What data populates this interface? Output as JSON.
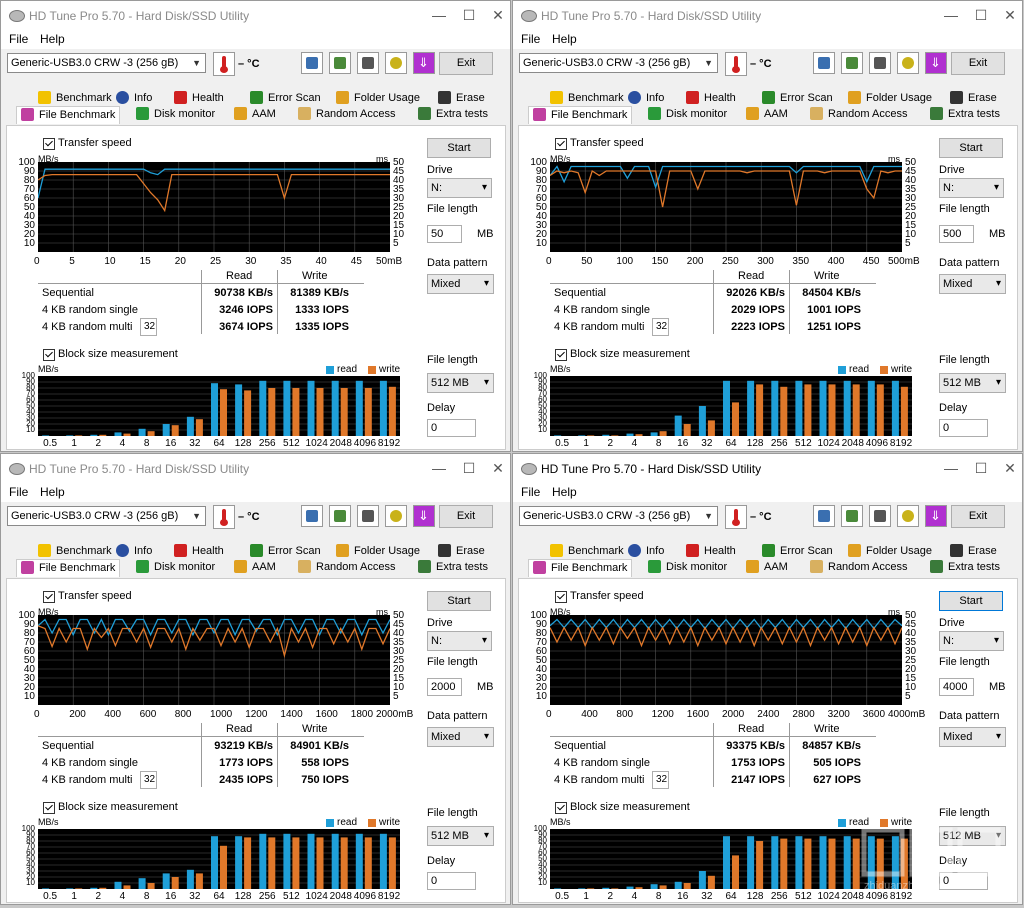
{
  "app": {
    "title": "HD Tune Pro 5.70 - Hard Disk/SSD Utility",
    "menu": [
      "File",
      "Help"
    ],
    "drive_name": "Generic-USB3.0 CRW   -3 (256 gB)",
    "temp": "– °C",
    "exit_label": "Exit",
    "tabs_row1": [
      "Benchmark",
      "Info",
      "Health",
      "Error Scan",
      "Folder Usage",
      "Erase"
    ],
    "tabs_row2": [
      "File Benchmark",
      "Disk monitor",
      "AAM",
      "Random Access",
      "Extra tests"
    ],
    "transfer_speed_label": "Transfer speed",
    "block_size_label": "Block size measurement",
    "start_label": "Start",
    "drive_label": "Drive",
    "drive_value": "N:",
    "file_length_label": "File length",
    "unit_mb": "MB",
    "data_pattern_label": "Data pattern",
    "data_pattern_value": "Mixed",
    "delay_label": "Delay",
    "delay_value": "0",
    "block_file_length": "512 MB",
    "mbs": "MB/s",
    "ms": "ms",
    "read_label": "Read",
    "write_label": "Write",
    "sequential": "Sequential",
    "kb_single": "4 KB random single",
    "kb_multi": "4 KB random multi",
    "queue": "32",
    "legend_read": "read",
    "legend_write": "write",
    "left_ticks": [
      "100",
      "90",
      "80",
      "70",
      "60",
      "50",
      "40",
      "30",
      "20",
      "10"
    ],
    "right_ticks": [
      "50",
      "45",
      "40",
      "35",
      "30",
      "25",
      "20",
      "15",
      "10",
      "5"
    ],
    "block_y_ticks": [
      "100",
      "90",
      "80",
      "70",
      "60",
      "50",
      "40",
      "30",
      "20",
      "10"
    ],
    "block_x": [
      "0.5",
      "1",
      "2",
      "4",
      "8",
      "16",
      "32",
      "64",
      "128",
      "256",
      "512",
      "1024",
      "2048",
      "4096",
      "8192"
    ],
    "colors": {
      "read": "#1f9fd8",
      "write": "#e0782a"
    },
    "watermark": "zhiduanzhi.com"
  },
  "windows": [
    {
      "file_length": "50",
      "x_ticks": [
        "0",
        "5",
        "10",
        "15",
        "20",
        "25",
        "30",
        "35",
        "40",
        "45",
        "50mB"
      ],
      "seq_read": "90738 KB/s",
      "seq_write": "81389 KB/s",
      "single_read": "3246 IOPS",
      "single_write": "1333 IOPS",
      "multi_read": "3674 IOPS",
      "multi_write": "1335 IOPS",
      "chart_data": {
        "type": "line",
        "x": [
          0,
          1,
          2,
          3,
          4,
          5,
          6,
          7,
          8,
          9,
          10,
          11,
          12,
          13,
          14,
          15,
          16,
          17,
          18,
          19,
          20,
          21,
          22,
          23,
          24,
          25,
          26,
          27,
          28,
          29,
          30,
          31,
          32,
          33,
          34,
          35,
          36,
          37,
          38,
          39,
          40,
          41,
          42,
          43,
          44,
          45,
          46,
          47,
          48,
          49,
          50
        ],
        "series": [
          {
            "name": "read",
            "values": [
              60,
              92,
              92,
              92,
              92,
              92,
              92,
              92,
              92,
              92,
              92,
              92,
              92,
              92,
              92,
              92,
              88,
              86,
              92,
              92,
              92,
              92,
              92,
              92,
              92,
              92,
              92,
              92,
              92,
              92,
              92,
              92,
              92,
              92,
              92,
              92,
              92,
              92,
              92,
              92,
              92,
              92,
              92,
              92,
              92,
              92,
              92,
              92,
              92,
              92,
              92
            ]
          },
          {
            "name": "write",
            "values": [
              80,
              85,
              86,
              86,
              86,
              86,
              86,
              86,
              86,
              86,
              86,
              86,
              86,
              86,
              86,
              76,
              66,
              58,
              46,
              86,
              86,
              86,
              86,
              86,
              86,
              86,
              86,
              86,
              86,
              86,
              86,
              86,
              86,
              86,
              86,
              60,
              86,
              86,
              86,
              86,
              86,
              86,
              86,
              86,
              86,
              86,
              86,
              86,
              86,
              86,
              86
            ]
          }
        ],
        "ylim": [
          0,
          100
        ],
        "block_read": [
          1,
          1,
          2,
          6,
          12,
          20,
          32,
          88,
          86,
          92,
          92,
          92,
          92,
          92,
          92
        ],
        "block_write": [
          0,
          1,
          2,
          4,
          8,
          18,
          28,
          78,
          76,
          80,
          80,
          80,
          80,
          80,
          82
        ]
      }
    },
    {
      "file_length": "500",
      "x_ticks": [
        "0",
        "50",
        "100",
        "150",
        "200",
        "250",
        "300",
        "350",
        "400",
        "450",
        "500mB"
      ],
      "seq_read": "92026 KB/s",
      "seq_write": "84504 KB/s",
      "single_read": "2029 IOPS",
      "single_write": "1001 IOPS",
      "multi_read": "2223 IOPS",
      "multi_write": "1251 IOPS",
      "chart_data": {
        "type": "line",
        "x": [
          0,
          10,
          20,
          30,
          40,
          50,
          60,
          70,
          80,
          90,
          100,
          110,
          120,
          130,
          140,
          150,
          160,
          170,
          180,
          190,
          200,
          210,
          220,
          230,
          240,
          250,
          260,
          270,
          280,
          290,
          300,
          310,
          320,
          330,
          340,
          350,
          360,
          370,
          380,
          390,
          400,
          410,
          420,
          430,
          440,
          450,
          460,
          470,
          480,
          490,
          500
        ],
        "series": [
          {
            "name": "read",
            "values": [
              85,
              95,
              78,
              95,
              95,
              95,
              95,
              95,
              95,
              95,
              95,
              82,
              95,
              95,
              95,
              72,
              95,
              95,
              95,
              95,
              95,
              95,
              95,
              95,
              95,
              95,
              95,
              95,
              95,
              95,
              95,
              95,
              95,
              95,
              95,
              88,
              95,
              95,
              95,
              95,
              95,
              95,
              95,
              95,
              95,
              78,
              95,
              95,
              95,
              95,
              95
            ]
          },
          {
            "name": "write",
            "values": [
              85,
              90,
              88,
              90,
              88,
              66,
              90,
              85,
              90,
              90,
              90,
              90,
              90,
              90,
              90,
              90,
              50,
              90,
              90,
              90,
              90,
              70,
              90,
              90,
              90,
              90,
              90,
              90,
              88,
              90,
              90,
              90,
              90,
              90,
              90,
              52,
              90,
              90,
              90,
              88,
              90,
              90,
              90,
              90,
              90,
              70,
              60,
              90,
              88,
              90,
              90
            ]
          }
        ],
        "ylim": [
          0,
          100
        ],
        "block_read": [
          1,
          1,
          2,
          4,
          6,
          34,
          50,
          92,
          92,
          92,
          92,
          92,
          92,
          92,
          92
        ],
        "block_write": [
          0,
          1,
          1,
          3,
          8,
          20,
          26,
          56,
          86,
          82,
          86,
          86,
          86,
          86,
          82
        ]
      }
    },
    {
      "file_length": "2000",
      "x_ticks": [
        "0",
        "200",
        "400",
        "600",
        "800",
        "1000",
        "1200",
        "1400",
        "1600",
        "1800",
        "2000mB"
      ],
      "seq_read": "93219 KB/s",
      "seq_write": "84901 KB/s",
      "single_read": "1773 IOPS",
      "single_write": "558 IOPS",
      "multi_read": "2435 IOPS",
      "multi_write": "750 IOPS",
      "chart_data": {
        "type": "line",
        "x": [
          0,
          40,
          80,
          120,
          160,
          200,
          240,
          280,
          320,
          360,
          400,
          440,
          480,
          520,
          560,
          600,
          640,
          680,
          720,
          760,
          800,
          840,
          880,
          920,
          960,
          1000,
          1040,
          1080,
          1120,
          1160,
          1200,
          1240,
          1280,
          1320,
          1360,
          1400,
          1440,
          1480,
          1520,
          1560,
          1600,
          1640,
          1680,
          1720,
          1760,
          1800,
          1840,
          1880,
          1920,
          1960,
          2000
        ],
        "series": [
          {
            "name": "read",
            "values": [
              88,
              95,
              80,
              95,
              95,
              78,
              95,
              95,
              80,
              95,
              78,
              95,
              95,
              82,
              95,
              95,
              78,
              95,
              95,
              80,
              95,
              95,
              78,
              95,
              95,
              80,
              95,
              95,
              78,
              95,
              95,
              82,
              95,
              95,
              78,
              95,
              95,
              80,
              95,
              95,
              78,
              95,
              95,
              80,
              95,
              95,
              78,
              95,
              95,
              80,
              95
            ]
          },
          {
            "name": "write",
            "values": [
              88,
              85,
              65,
              85,
              70,
              85,
              85,
              62,
              85,
              75,
              85,
              66,
              85,
              85,
              70,
              85,
              64,
              85,
              85,
              70,
              85,
              62,
              85,
              72,
              85,
              85,
              66,
              85,
              70,
              85,
              64,
              85,
              85,
              70,
              85,
              55,
              85,
              70,
              85,
              64,
              85,
              85,
              68,
              85,
              70,
              85,
              62,
              85,
              85,
              68,
              85
            ]
          }
        ],
        "ylim": [
          0,
          100
        ],
        "block_read": [
          1,
          1,
          2,
          12,
          18,
          26,
          32,
          88,
          88,
          92,
          92,
          92,
          92,
          92,
          92
        ],
        "block_write": [
          0,
          1,
          2,
          6,
          10,
          20,
          26,
          72,
          86,
          86,
          86,
          86,
          86,
          86,
          86
        ]
      }
    },
    {
      "file_length": "4000",
      "x_ticks": [
        "0",
        "400",
        "800",
        "1200",
        "1600",
        "2000",
        "2400",
        "2800",
        "3200",
        "3600",
        "4000mB"
      ],
      "seq_read": "93375 KB/s",
      "seq_write": "84857 KB/s",
      "single_read": "1753 IOPS",
      "single_write": "505 IOPS",
      "multi_read": "2147 IOPS",
      "multi_write": "627 IOPS",
      "chart_data": {
        "type": "line",
        "x": [
          0,
          80,
          160,
          240,
          320,
          400,
          480,
          560,
          640,
          720,
          800,
          880,
          960,
          1040,
          1120,
          1200,
          1280,
          1360,
          1440,
          1520,
          1600,
          1680,
          1760,
          1840,
          1920,
          2000,
          2080,
          2160,
          2240,
          2320,
          2400,
          2480,
          2560,
          2640,
          2720,
          2800,
          2880,
          2960,
          3040,
          3120,
          3200,
          3280,
          3360,
          3440,
          3520,
          3600,
          3680,
          3760,
          3840,
          3920,
          4000
        ],
        "series": [
          {
            "name": "read",
            "values": [
              88,
              95,
              86,
              95,
              86,
              95,
              85,
              95,
              86,
              95,
              85,
              95,
              86,
              95,
              85,
              95,
              86,
              95,
              85,
              95,
              86,
              95,
              85,
              95,
              86,
              95,
              85,
              95,
              86,
              95,
              85,
              95,
              86,
              95,
              85,
              95,
              86,
              95,
              85,
              95,
              86,
              95,
              85,
              95,
              86,
              95,
              85,
              95,
              86,
              95,
              88
            ]
          },
          {
            "name": "write",
            "values": [
              86,
              70,
              86,
              72,
              86,
              66,
              86,
              72,
              86,
              68,
              86,
              74,
              86,
              66,
              86,
              72,
              86,
              68,
              86,
              70,
              86,
              66,
              86,
              72,
              86,
              68,
              86,
              70,
              86,
              66,
              86,
              72,
              86,
              68,
              86,
              70,
              86,
              66,
              86,
              72,
              86,
              68,
              86,
              70,
              86,
              66,
              86,
              72,
              86,
              68,
              86
            ]
          }
        ],
        "ylim": [
          0,
          100
        ],
        "block_read": [
          1,
          1,
          2,
          4,
          8,
          12,
          30,
          88,
          88,
          88,
          88,
          88,
          88,
          88,
          88
        ],
        "block_write": [
          0,
          1,
          1,
          3,
          6,
          10,
          22,
          56,
          80,
          84,
          84,
          84,
          84,
          84,
          84
        ]
      }
    }
  ]
}
